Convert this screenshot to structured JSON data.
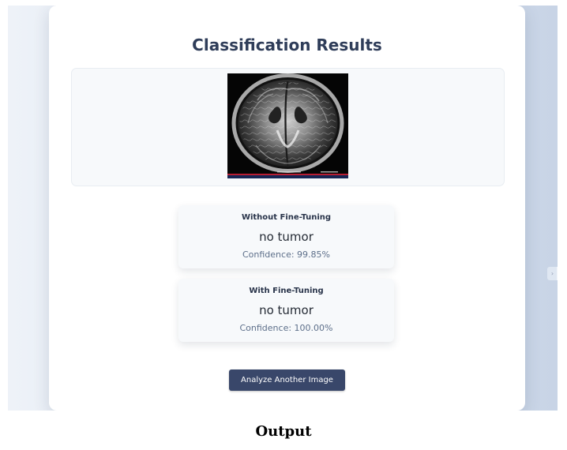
{
  "page": {
    "title": "Classification Results",
    "caption": "Output",
    "side_handle_icon": "›"
  },
  "image": {
    "alt": "Brain MRI scan",
    "icon": "brain-mri-scan"
  },
  "results": [
    {
      "title": "Without Fine-Tuning",
      "label": "no tumor",
      "confidence": "Confidence: 99.85%"
    },
    {
      "title": "With Fine-Tuning",
      "label": "no tumor",
      "confidence": "Confidence: 100.00%"
    }
  ],
  "actions": {
    "analyze_another": "Analyze Another Image"
  },
  "colors": {
    "title": "#2f3d59",
    "button": "#39476a",
    "confidence": "#5d6f8a",
    "panel": "#f7f9fb"
  }
}
